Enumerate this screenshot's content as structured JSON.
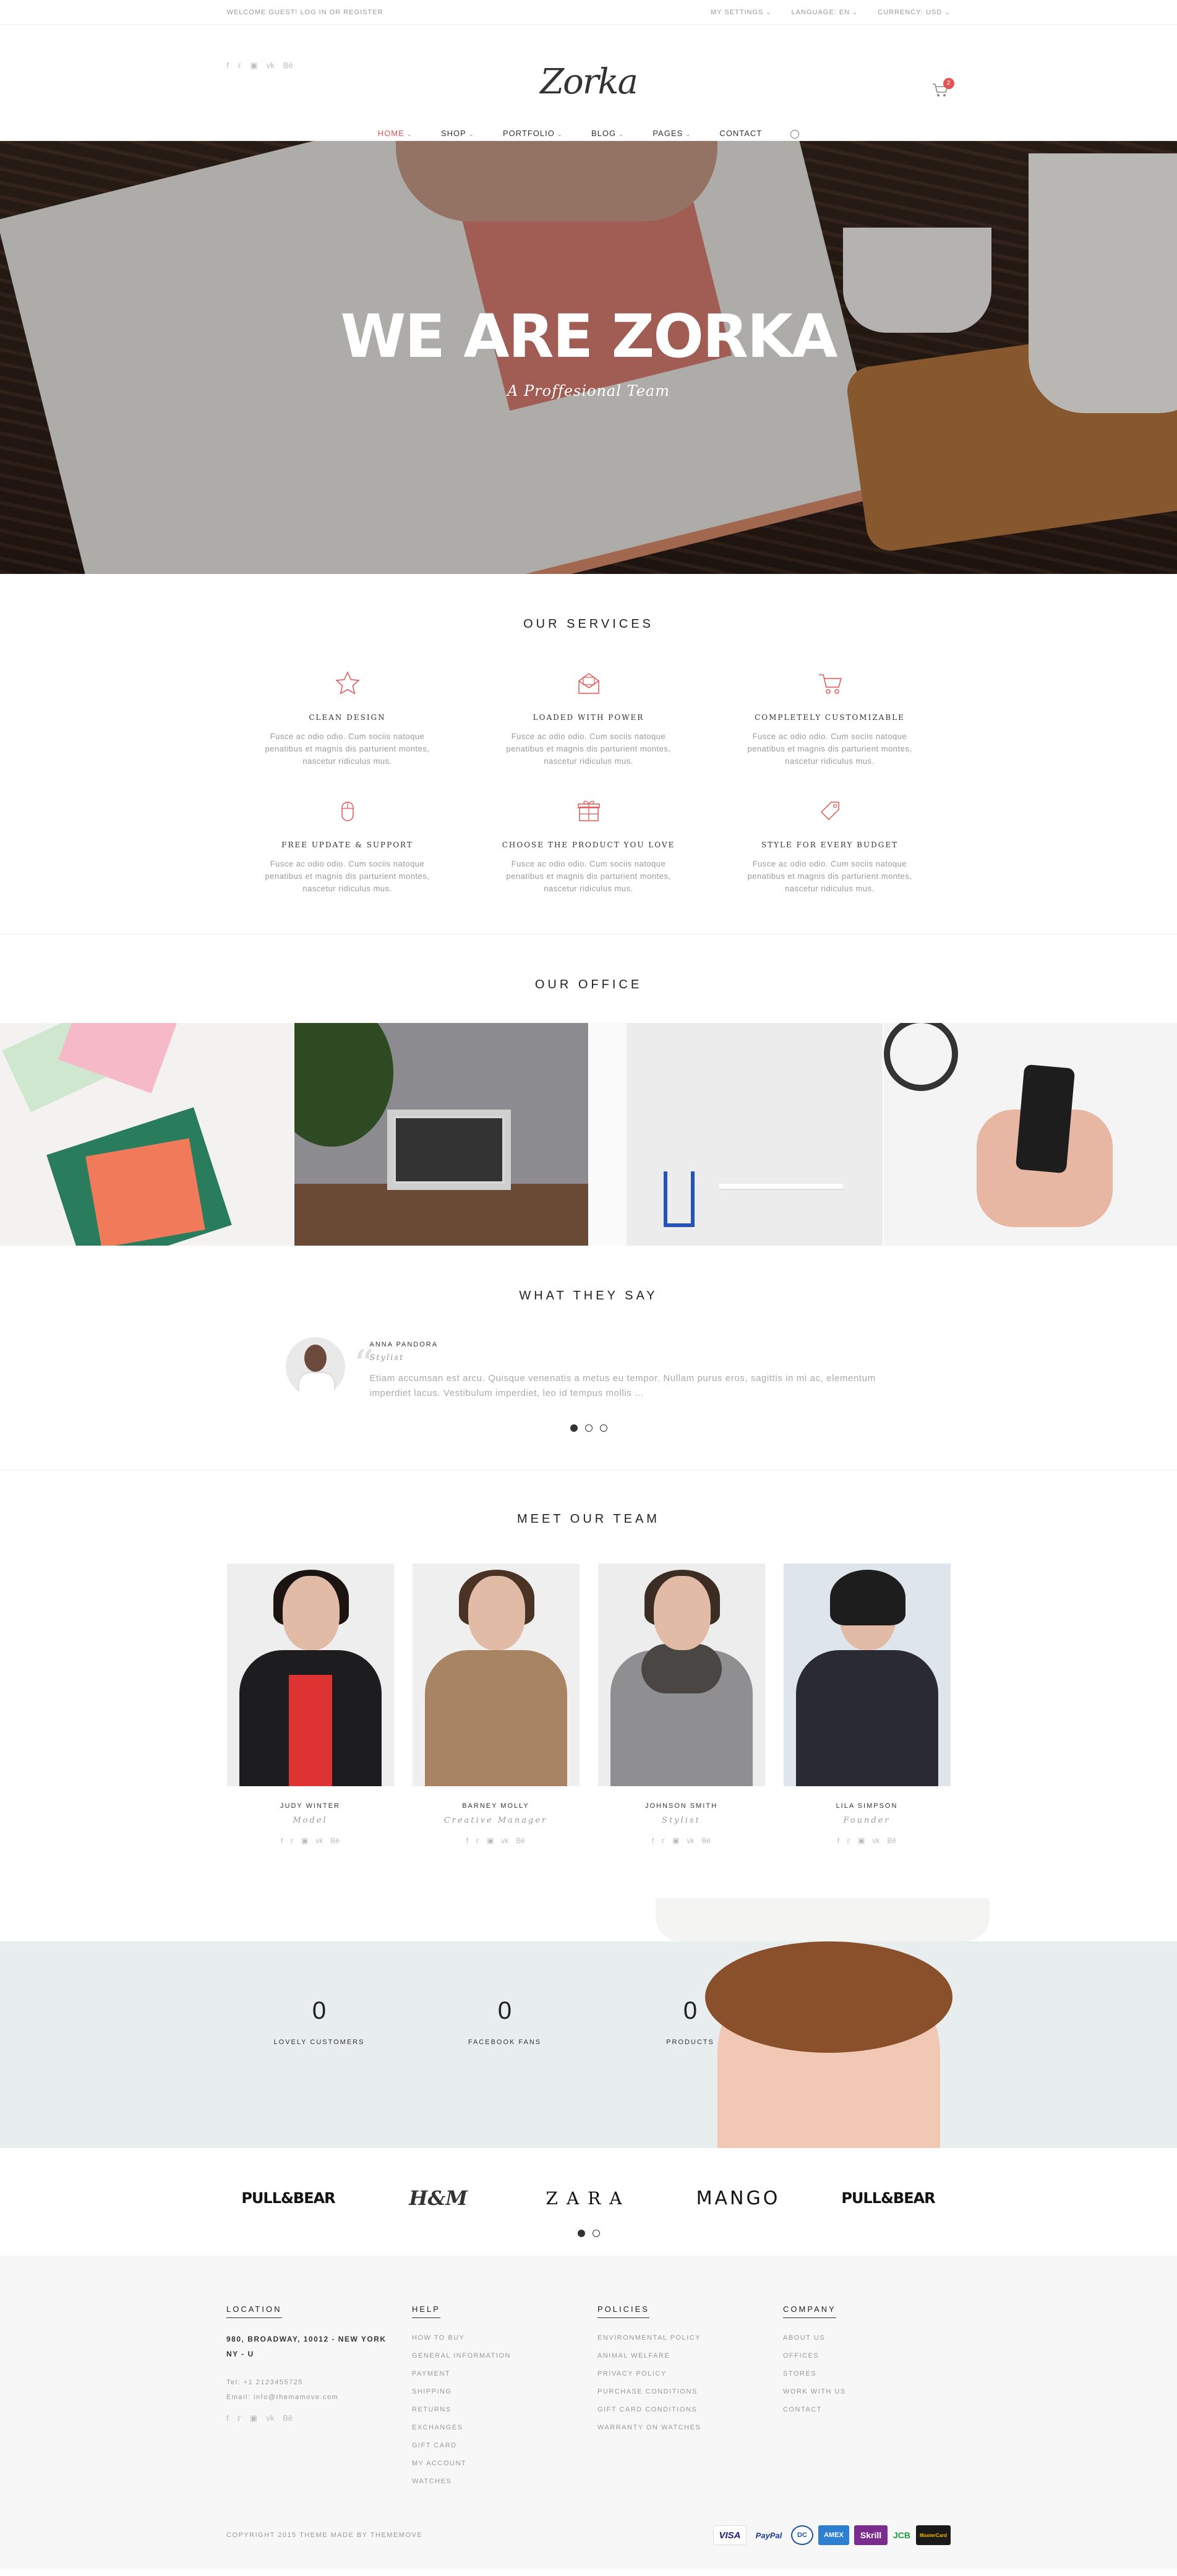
{
  "topbar": {
    "welcome": "Welcome Guest! Log in or Register",
    "settings": "My Settings",
    "language": "Language: EN",
    "currency": "Currency: USD"
  },
  "header": {
    "logo": "Zorka",
    "cart_count": "2",
    "social_icons": [
      "facebook-icon",
      "twitter-icon",
      "instagram-icon",
      "vk-icon",
      "behance-icon"
    ]
  },
  "nav": {
    "items": [
      {
        "label": "Home",
        "dropdown": true,
        "active": true
      },
      {
        "label": "Shop",
        "dropdown": true
      },
      {
        "label": "Portfolio",
        "dropdown": true
      },
      {
        "label": "Blog",
        "dropdown": true
      },
      {
        "label": "Pages",
        "dropdown": true
      },
      {
        "label": "Contact",
        "dropdown": false
      }
    ]
  },
  "hero": {
    "title": "WE ARE ZORKA",
    "subtitle": "A Proffesional Team"
  },
  "services": {
    "title": "Our Services",
    "items": [
      {
        "icon": "star-icon",
        "title": "Clean Design",
        "text": "Fusce ac odio odio. Cum sociis natoque penatibus et magnis dis parturient montes, nascetur ridiculus mus."
      },
      {
        "icon": "envelope-icon",
        "title": "Loaded with power",
        "text": "Fusce ac odio odio. Cum sociis natoque penatibus et magnis dis parturient montes, nascetur ridiculus mus."
      },
      {
        "icon": "cart-icon",
        "title": "Completely Customizable",
        "text": "Fusce ac odio odio. Cum sociis natoque penatibus et magnis dis parturient montes, nascetur ridiculus mus."
      },
      {
        "icon": "mouse-icon",
        "title": "Free update & support",
        "text": "Fusce ac odio odio. Cum sociis natoque penatibus et magnis dis parturient montes, nascetur ridiculus mus."
      },
      {
        "icon": "gift-icon",
        "title": "Choose the product you love",
        "text": "Fusce ac odio odio. Cum sociis natoque penatibus et magnis dis parturient montes, nascetur ridiculus mus."
      },
      {
        "icon": "tag-icon",
        "title": "Style for every budget",
        "text": "Fusce ac odio odio. Cum sociis natoque penatibus et magnis dis parturient montes, nascetur ridiculus mus."
      }
    ]
  },
  "office": {
    "title": "Our Office"
  },
  "testimonial": {
    "title": "What They Say",
    "name": "Anna Pandora",
    "role": "Stylist",
    "quote": "Etiam accumsan est arcu. Quisque venenatis a metus eu tempor. Nullam purus eros, sagittis in mi ac, elementum imperdiet lacus. Vestibulum imperdiet, leo id tempus mollis ..."
  },
  "team": {
    "title": "Meet Our Team",
    "members": [
      {
        "name": "Judy Winter",
        "role": "Model"
      },
      {
        "name": "Barney Molly",
        "role": "Creative Manager"
      },
      {
        "name": "Johnson Smith",
        "role": "Stylist"
      },
      {
        "name": "Lila Simpson",
        "role": "Founder"
      }
    ]
  },
  "counters": [
    {
      "value": "0",
      "label": "Lovely Customers"
    },
    {
      "value": "0",
      "label": "Facebook Fans"
    },
    {
      "value": "0",
      "label": "Products"
    }
  ],
  "brands": [
    "PULL&BEAR",
    "H&M",
    "ZARA",
    "MANGO",
    "PULL&BEAR"
  ],
  "footer": {
    "location": {
      "title": "Location",
      "address": "980, Broadway, 10012 - New York NY - U",
      "tel": "Tel: +1 2123455725",
      "email": "Email: info@themamove.com"
    },
    "help": {
      "title": "Help",
      "links": [
        "How to buy",
        "General information",
        "Payment",
        "Shipping",
        "Returns",
        "Exchanges",
        "Gift card",
        "My account",
        "Watches"
      ]
    },
    "policies": {
      "title": "Policies",
      "links": [
        "Environmental policy",
        "Animal welfare",
        "Privacy policy",
        "Purchase conditions",
        "Gift card conditions",
        "Warranty on watches"
      ]
    },
    "company": {
      "title": "Company",
      "links": [
        "About us",
        "Offices",
        "Stores",
        "Work with us",
        "Contact"
      ]
    },
    "copyright": "Copyright 2015 Theme made by Thememove",
    "payments": [
      {
        "label": "VISA",
        "icon": "visa-icon"
      },
      {
        "label": "PayPal",
        "icon": "paypal-icon"
      },
      {
        "label": "DC",
        "icon": "diners-club-icon"
      },
      {
        "label": "AMEX",
        "icon": "amex-icon"
      },
      {
        "label": "Skrill",
        "icon": "skrill-icon"
      },
      {
        "label": "JCB",
        "icon": "jcb-icon"
      },
      {
        "label": "MasterCard",
        "icon": "mastercard-icon"
      }
    ]
  },
  "colors": {
    "accent": "#e25555",
    "text": "#333333",
    "muted": "#999999"
  }
}
